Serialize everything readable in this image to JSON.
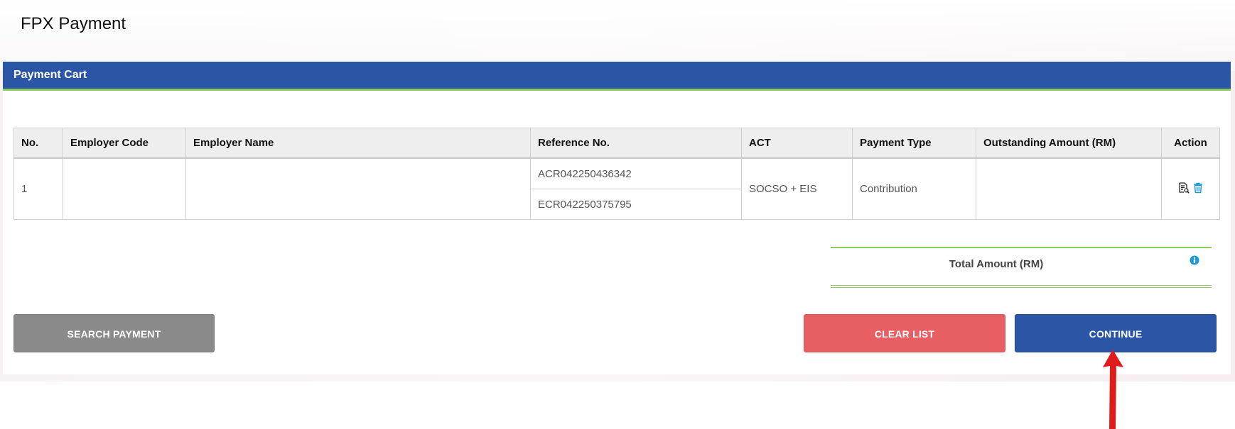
{
  "page": {
    "title": "FPX Payment"
  },
  "cart": {
    "header": "Payment Cart",
    "columns": [
      "No.",
      "Employer Code",
      "Employer Name",
      "Reference No.",
      "ACT",
      "Payment Type",
      "Outstanding Amount (RM)",
      "Action"
    ],
    "rows": [
      {
        "no": "1",
        "employer_code": "",
        "employer_name": "",
        "reference_nos": [
          "ACR042250436342",
          "ECR042250375795"
        ],
        "act": "SOCSO + EIS",
        "payment_type": "Contribution",
        "outstanding_amount": ""
      }
    ],
    "action_icons": [
      "view-document-icon",
      "trash-icon"
    ]
  },
  "total": {
    "label": "Total Amount (RM)",
    "value": "",
    "icon": "info-icon"
  },
  "buttons": {
    "search": "SEARCH PAYMENT",
    "clear": "CLEAR LIST",
    "continue": "CONTINUE"
  },
  "colors": {
    "header": "#2a56a5",
    "accent_rule": "#8ccc5a",
    "search_button": "#8a8a8a",
    "clear_button": "#e85f63",
    "continue_button": "#2a56a5",
    "annotation_arrow": "#e01b1b"
  }
}
